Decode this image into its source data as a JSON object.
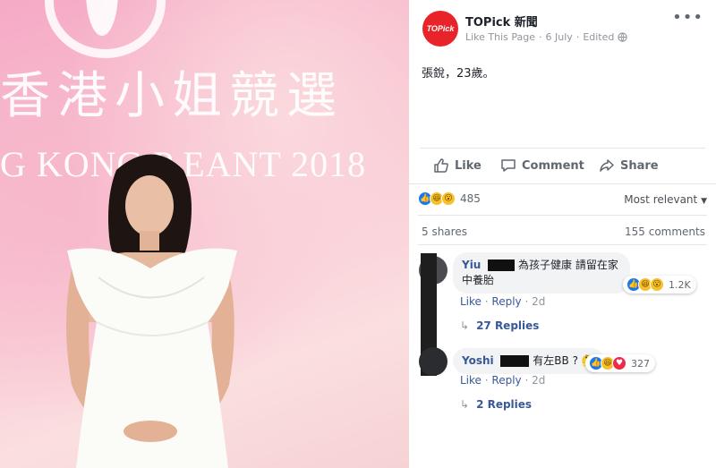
{
  "photo": {
    "banner_cn": "香港小姐競選",
    "banner_en": "G KONG P   EANT 2018"
  },
  "post": {
    "avatar_text": "TOPick",
    "page_name": "TOPick 新聞",
    "like_page": "Like This Page",
    "date": "6 July",
    "edited": "Edited",
    "text": "張銳，23歲。",
    "more_icon": "more-dots-icon",
    "actions": {
      "like": "Like",
      "comment": "Comment",
      "share": "Share"
    },
    "reactions": {
      "types": [
        "like",
        "haha",
        "wow"
      ],
      "count": "485"
    },
    "sort_label": "Most relevant",
    "shares": "5 shares",
    "comments_count": "155 comments"
  },
  "comments": [
    {
      "author": "Yiu",
      "text_line1": "為孩子健康 請留在家",
      "text_line2": "中養胎",
      "reaction_count": "1.2K",
      "actions": {
        "like": "Like",
        "reply": "Reply",
        "age": "2d"
      },
      "replies": "27 Replies"
    },
    {
      "author": "Yoshi",
      "text": "有左BB ?",
      "reaction_count": "327",
      "actions": {
        "like": "Like",
        "reply": "Reply",
        "age": "2d"
      },
      "replies": "2 Replies"
    }
  ],
  "colors": {
    "facebook_blue": "#1877f2",
    "link": "#385898",
    "brand_red": "#e8232a"
  }
}
